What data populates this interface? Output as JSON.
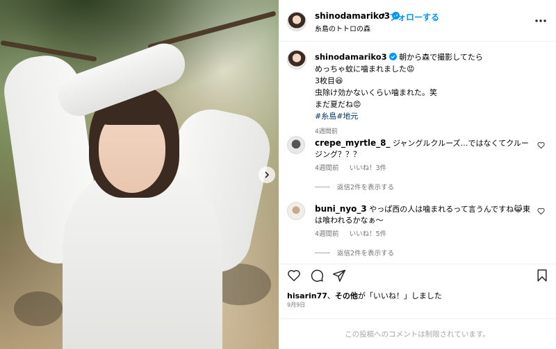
{
  "post": {
    "username": "shinodamariko3",
    "follow_label": "フォローする",
    "separator": "•",
    "location": "糸島のトトロの森",
    "caption_lines": [
      "朝から森で撮影してたら",
      "めっちゃ蚊に噛まれました😡",
      "3枚目😆",
      "虫除け効かないくらい噛まれた。笑",
      "まだ夏だね😡"
    ],
    "hashtags": "#糸島#地元",
    "caption_time": "4週間前"
  },
  "comments": [
    {
      "username": "crepe_myrtle_8_",
      "text": "ジャングルクルーズ…ではなくてクルージング？？？",
      "time": "4週間前",
      "likes": "いいね！3件",
      "replies": "返信2件を表示する"
    },
    {
      "username": "buni_nyo_3",
      "text": "やっぱ西の人は噛まれるって言うんですね😹東は喰われるかなぁ〜",
      "time": "4週間前",
      "likes": "いいね！5件",
      "replies": "返信2件を表示する"
    }
  ],
  "likes_bar": {
    "liker": "hisarin77",
    "others": "その他",
    "suffix": "が「いいね！」しました",
    "date": "9月9日"
  },
  "comments_disabled": "この投稿へのコメントは制限されています。",
  "colors": {
    "link": "#0095f6",
    "verified": "#0095f6",
    "hashtag": "#00376b",
    "muted": "#737373"
  }
}
